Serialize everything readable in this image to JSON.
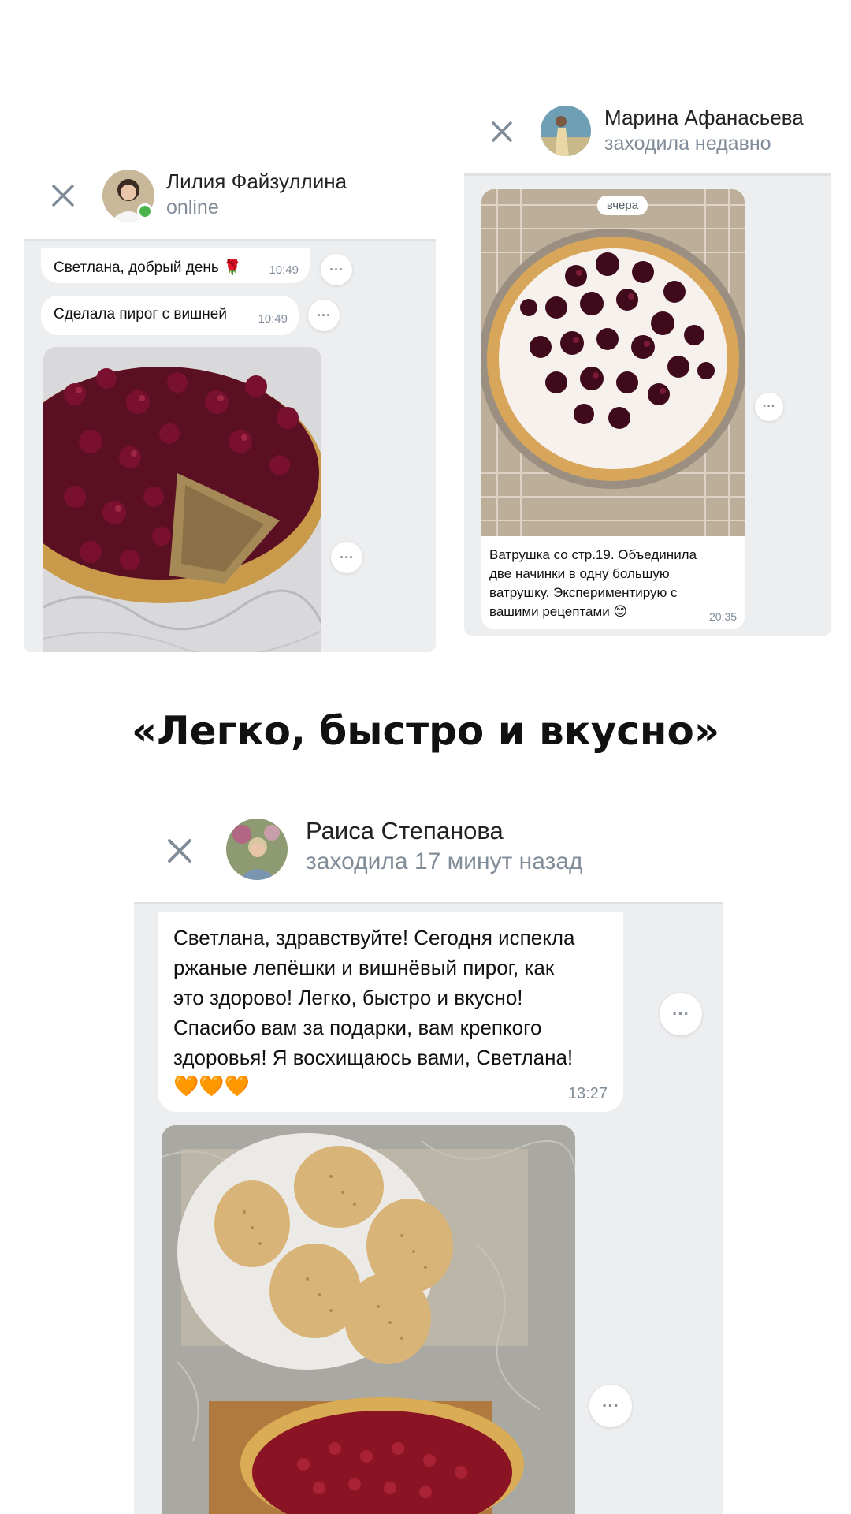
{
  "chats": [
    {
      "contact_name": "Лилия Файзуллина",
      "status": "online",
      "messages": [
        {
          "text": "Светлана, добрый день 🌹",
          "time": "10:49"
        },
        {
          "text": "Сделала пирог с вишней",
          "time": "10:49"
        }
      ],
      "photo": "cherry-pie-photo"
    },
    {
      "contact_name": "Марина Афанасьева",
      "status": "заходила недавно",
      "date_badge": "вчера",
      "photo": "cherry-tart-photo",
      "caption_lines": [
        "Ватрушка со стр.19. Объединила",
        "две начинки в одну большую",
        "ватрушку.  Экспериментирую с",
        "вашими рецептами 😊"
      ],
      "caption_time": "20:35"
    },
    {
      "contact_name": "Раиса Степанова",
      "status": "заходила 17 минут назад",
      "message_lines": [
        "Светлана, здравствуйте! Сегодня испекла",
        "ржаные лепёшки и вишнёвый пирог, как",
        "это здорово! Легко, быстро и вкусно!",
        "Спасибо вам за подарки, вам крепкого",
        "здоровья! Я восхищаюсь вами, Светлана!",
        "🧡🧡🧡"
      ],
      "message_time": "13:27",
      "photo": "flatbreads-and-pie-photo"
    }
  ],
  "tagline": "«Легко, быстро и вкусно»",
  "icons": {
    "close": "close-icon",
    "more": "more-icon"
  },
  "colors": {
    "secondary_text": "#818c99",
    "chat_bg": "#edeef0",
    "online": "#4bb34b"
  }
}
